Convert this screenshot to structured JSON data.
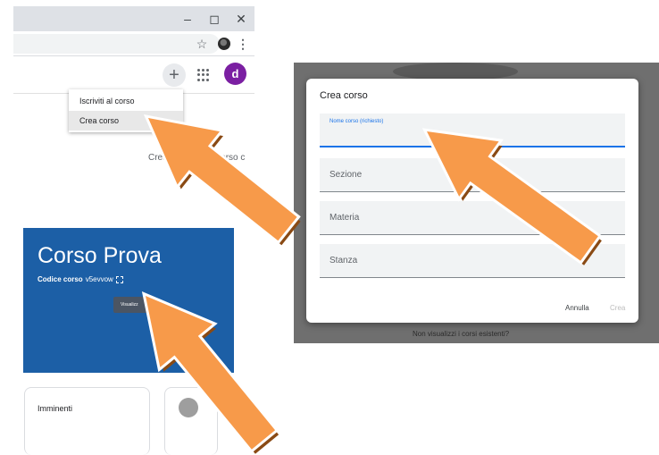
{
  "browser": {
    "window_controls": {
      "minimize": "–",
      "maximize": "◻",
      "close": "✕"
    },
    "star_icon": "☆",
    "menu_icon": "⋮"
  },
  "appbar": {
    "plus_label": "+",
    "avatar_letter": "d",
    "avatar_color": "#7b1fa2"
  },
  "menu": {
    "items": [
      {
        "label": "Iscriviti al corso"
      },
      {
        "label": "Crea corso"
      }
    ]
  },
  "empty_state": {
    "text": "Crea il tuo primo corso c"
  },
  "course_card": {
    "name": "Corso Prova",
    "code_label": "Codice corso",
    "code_value": "v5evvow",
    "button_label": "Visualizz",
    "color": "#1c5fa6"
  },
  "upcoming_card": {
    "title": "Imminenti"
  },
  "dialog": {
    "title": "Crea corso",
    "fields": [
      {
        "label": "Nome corso (richiesto)"
      },
      {
        "label": "Sezione"
      },
      {
        "label": "Materia"
      },
      {
        "label": "Stanza"
      }
    ],
    "cancel_label": "Annulla",
    "create_label": "Crea",
    "background_text": "Non visualizzi i corsi esistenti?"
  },
  "arrow_color": "#f79a4a"
}
